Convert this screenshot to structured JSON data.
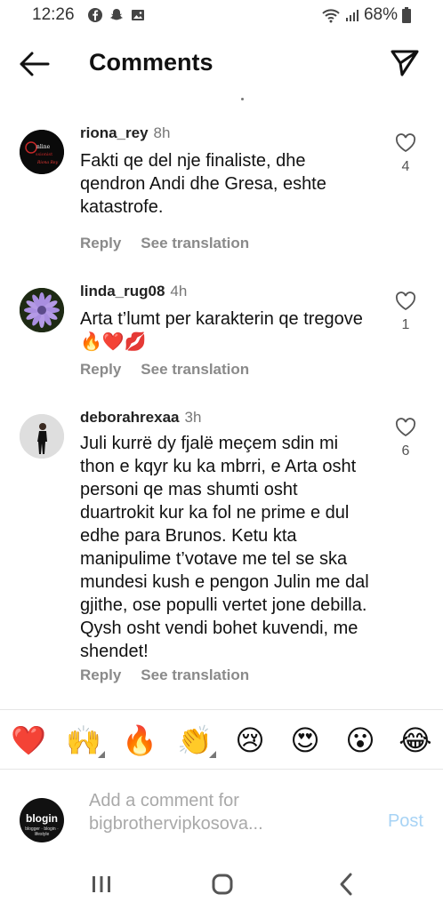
{
  "status_bar": {
    "time": "12:26",
    "battery": "68%",
    "icons": [
      "facebook-icon",
      "snapchat-icon",
      "gallery-icon",
      "wifi-icon",
      "signal-icon",
      "battery-icon"
    ]
  },
  "header": {
    "title": "Comments",
    "back_icon": "arrow-left-icon",
    "share_icon": "paper-plane-icon"
  },
  "comments": [
    {
      "username": "riona_rey",
      "time": "8h",
      "text": "Fakti qe del nje finaliste, dhe qendron Andi dhe Gresa, eshte katastrofe.",
      "likes": "4",
      "reply": "Reply",
      "see_translation": "See translation",
      "avatar_lines": [
        "nline",
        "ssionist",
        "Riona Rey"
      ]
    },
    {
      "username": "linda_rug08",
      "time": "4h",
      "text": "Arta t’lumt per karakterin qe tregove 🔥❤️💋",
      "likes": "1",
      "reply": "Reply",
      "see_translation": "See translation"
    },
    {
      "username": "deborahrexaa",
      "time": "3h",
      "text": "Juli kurrë dy fjalë meçem sdin mi thon e kqyr ku ka mbrri, e Arta osht personi qe mas shumti osht duartrokit kur ka fol ne prime e dul edhe para Brunos. Ketu kta manipulime t’votave me tel se ska mundesi kush e pengon Julin me dal gjithe, ose populli vertet jone debilla. Qysh osht vendi bohet kuvendi, me shendet!",
      "likes": "6",
      "reply": "Reply",
      "see_translation": "See translation"
    }
  ],
  "emoji_bar": [
    "❤️",
    "🙌",
    "🔥",
    "👏",
    "😢",
    "😍",
    "😮",
    "😂"
  ],
  "composer": {
    "placeholder": "Add a comment for bigbrothervipkosova...",
    "post": "Post",
    "avatar_text": "blogin",
    "avatar_subtext": "blogger · blogin · lifestyle"
  },
  "nav_bar": [
    "recent-apps-icon",
    "home-icon",
    "back-icon"
  ],
  "colors": {
    "accent_post": "#a7d3f5",
    "secondary_text": "#8a8a8a"
  }
}
